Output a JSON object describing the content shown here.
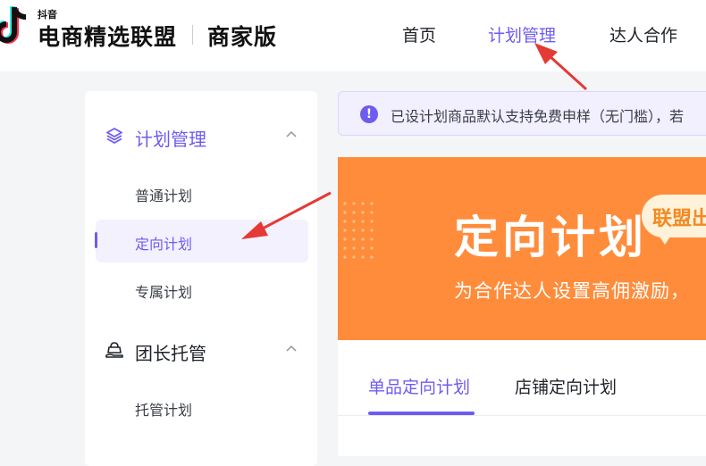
{
  "header": {
    "brand_small": "抖音",
    "brand_main": "电商精选联盟",
    "brand_sub": "商家版",
    "nav": [
      {
        "label": "首页",
        "active": false
      },
      {
        "label": "计划管理",
        "active": true
      },
      {
        "label": "达人合作",
        "active": false
      }
    ]
  },
  "sidebar": {
    "sections": [
      {
        "label": "计划管理",
        "icon": "layers-icon",
        "expanded": true,
        "items": [
          {
            "label": "普通计划",
            "active": false
          },
          {
            "label": "定向计划",
            "active": true
          },
          {
            "label": "专属计划",
            "active": false
          }
        ]
      },
      {
        "label": "团长托管",
        "icon": "hand-bag-icon",
        "expanded": true,
        "items": [
          {
            "label": "托管计划",
            "active": false
          }
        ]
      }
    ]
  },
  "notice": {
    "icon": "exclamation-circle-icon",
    "text": "已设计划商品默认支持免费申样（无门槛），若"
  },
  "banner": {
    "title": "定向计划",
    "badge": "联盟出",
    "subtitle": "为合作达人设置高佣激励，"
  },
  "tabs": [
    {
      "label": "单品定向计划",
      "active": true
    },
    {
      "label": "店铺定向计划",
      "active": false
    }
  ],
  "colors": {
    "accent": "#6e5cf0",
    "banner": "#ff8c3b",
    "annotation_arrow": "#e53935"
  }
}
